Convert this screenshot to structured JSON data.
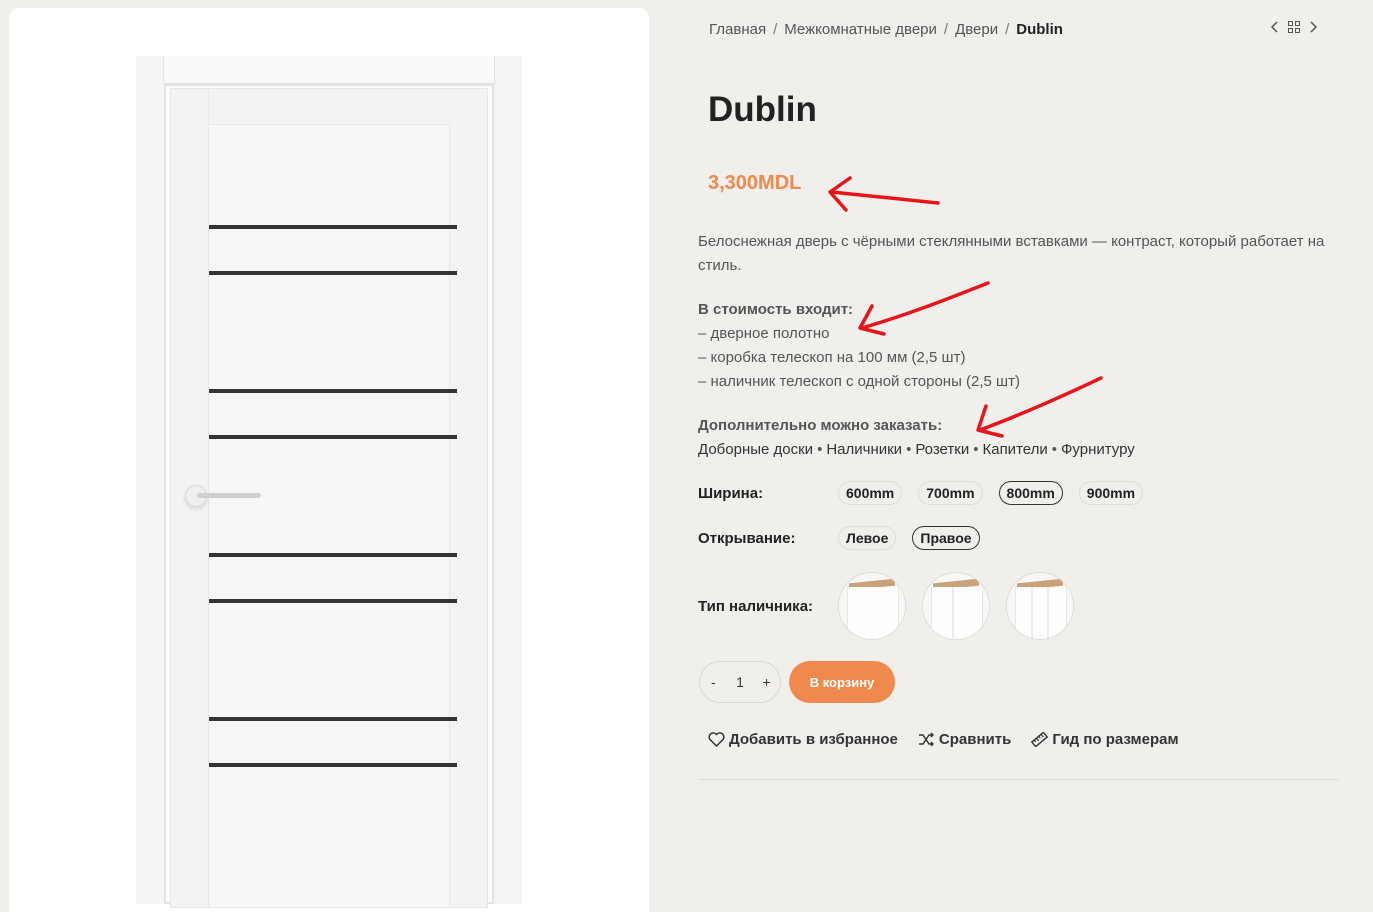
{
  "breadcrumb": {
    "items": [
      "Главная",
      "Межкомнатные двери",
      "Двери"
    ],
    "current": "Dublin",
    "separator": "/"
  },
  "product": {
    "title": "Dublin",
    "price": "3,300MDL",
    "description": "Белоснежная дверь с чёрными стеклянными вставками — контраст, который работает на стиль.",
    "includes_heading": "В стоимость входит:",
    "includes": [
      "– дверное полотно",
      "– коробка телескоп на 100 мм (2,5 шт)",
      "– наличник телескоп с одной стороны (2,5 шт)"
    ],
    "extras_heading": "Дополнительно можно заказать:",
    "extras": [
      "Доборные доски",
      "Наличники",
      "Розетки",
      "Капители",
      "Фурнитуру"
    ]
  },
  "options": {
    "width": {
      "label": "Ширина",
      "values": [
        "600mm",
        "700mm",
        "800mm",
        "900mm"
      ],
      "selected": "800mm"
    },
    "opening": {
      "label": "Открывание",
      "values": [
        "Левое",
        "Правое"
      ],
      "selected": "Правое"
    },
    "trim": {
      "label": "Тип наличника",
      "count": 3
    }
  },
  "cart": {
    "minus": "-",
    "quantity": "1",
    "plus": "+",
    "add_label": "В корзину"
  },
  "actions": {
    "wishlist": "Добавить в избранное",
    "compare": "Сравнить",
    "size_guide": "Гид по размерам"
  },
  "colors": {
    "accent": "#f0894d",
    "annotation_arrow": "#e8141c",
    "background": "#f1efeb"
  },
  "icons": {
    "prev": "chevron-left-icon",
    "grid": "grid-icon",
    "next": "chevron-right-icon",
    "wishlist": "heart-icon",
    "compare": "shuffle-icon",
    "size_guide": "ruler-icon"
  }
}
